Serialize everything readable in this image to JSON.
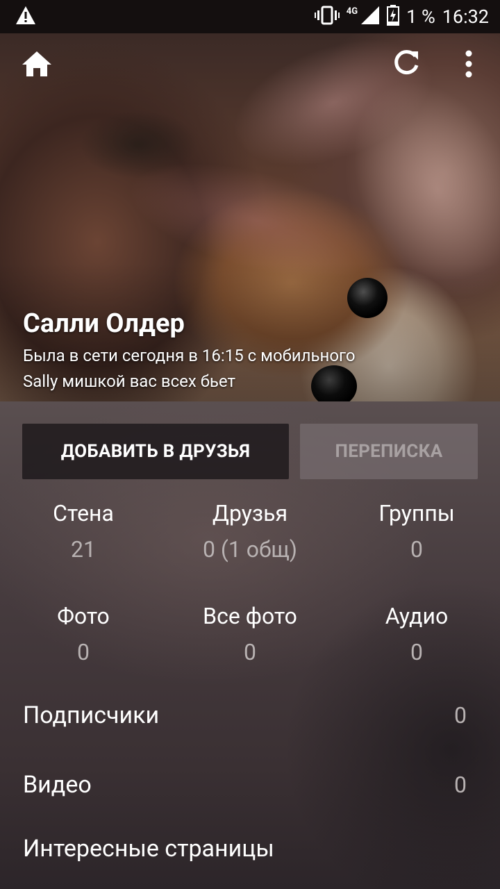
{
  "status_bar": {
    "battery_text": "1 %",
    "time": "16:32",
    "network": "4G",
    "icons": [
      "warning-icon",
      "vibrate-icon",
      "signal-icon",
      "battery-charging-icon"
    ]
  },
  "toolbar": {
    "icons": [
      "home-icon",
      "refresh-icon",
      "more-vert-icon"
    ]
  },
  "profile": {
    "name": "Салли Олдер",
    "last_seen": "Была в сети сегодня в 16:15 с мобильного",
    "status": "Sally мишкой вас всех бьет"
  },
  "buttons": {
    "add_friend": "ДОБАВИТЬ В ДРУЗЬЯ",
    "messages": "ПЕРЕПИСКА"
  },
  "stats": [
    {
      "label": "Стена",
      "value": "21"
    },
    {
      "label": "Друзья",
      "value": "0 (1 общ)"
    },
    {
      "label": "Группы",
      "value": "0"
    },
    {
      "label": "Фото",
      "value": "0"
    },
    {
      "label": "Все фото",
      "value": "0"
    },
    {
      "label": "Аудио",
      "value": "0"
    }
  ],
  "list": [
    {
      "label": "Подписчики",
      "value": "0"
    },
    {
      "label": "Видео",
      "value": "0"
    },
    {
      "label": "Интересные страницы",
      "value": ""
    }
  ],
  "colors": {
    "status_bar_bg": "#140f0f",
    "button_primary_bg": "#1e1a1c",
    "button_disabled_text": "#a8a1a2",
    "value_text": "#b8b2b2"
  }
}
